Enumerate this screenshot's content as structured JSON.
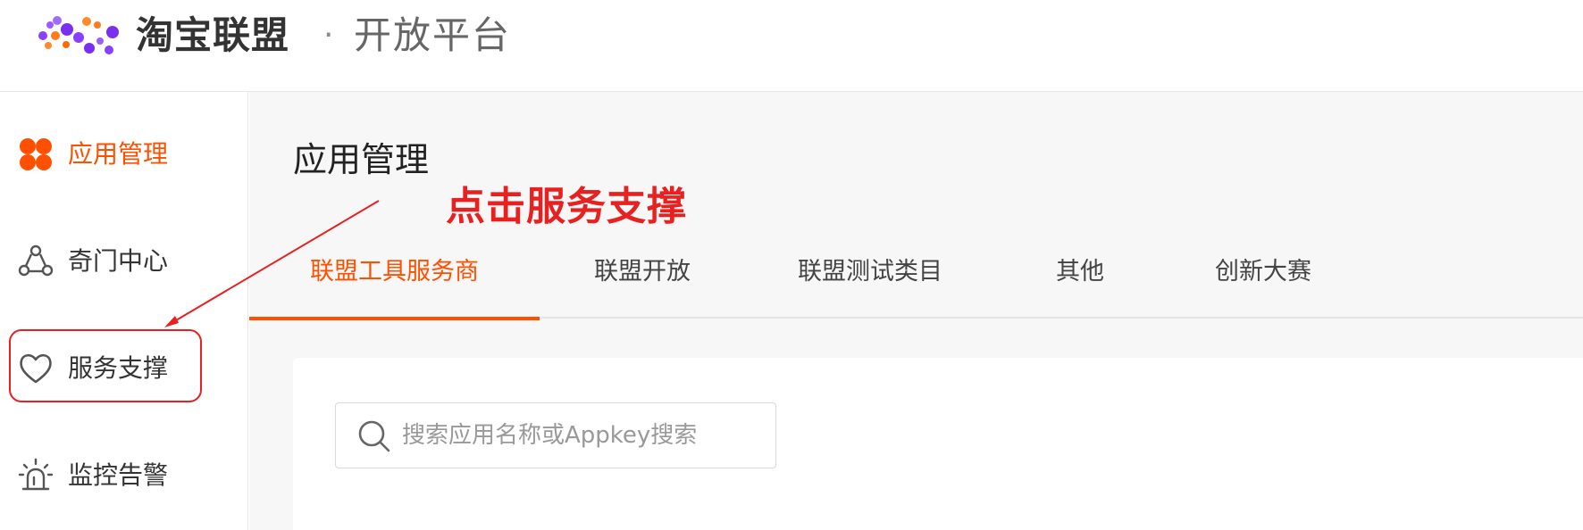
{
  "header": {
    "brand": "淘宝联盟",
    "separator": "·",
    "platform": "开放平台"
  },
  "sidebar": {
    "items": [
      {
        "label": "应用管理",
        "icon": "app-grid-icon",
        "active": true
      },
      {
        "label": "奇门中心",
        "icon": "network-icon",
        "active": false
      },
      {
        "label": "服务支撑",
        "icon": "heart-icon",
        "active": false
      },
      {
        "label": "监控告警",
        "icon": "alarm-light-icon",
        "active": false
      }
    ]
  },
  "main": {
    "title": "应用管理",
    "tabs": [
      {
        "label": "联盟工具服务商",
        "active": true
      },
      {
        "label": "联盟开放",
        "active": false
      },
      {
        "label": "联盟测试类目",
        "active": false
      },
      {
        "label": "其他",
        "active": false
      },
      {
        "label": "创新大赛",
        "active": false
      }
    ],
    "search": {
      "placeholder": "搜索应用名称或Appkey搜索",
      "value": ""
    }
  },
  "annotation": {
    "text": "点击服务支撑",
    "color": "#e8201f"
  },
  "colors": {
    "accent": "#ff5000",
    "annotation": "#e8201f"
  }
}
